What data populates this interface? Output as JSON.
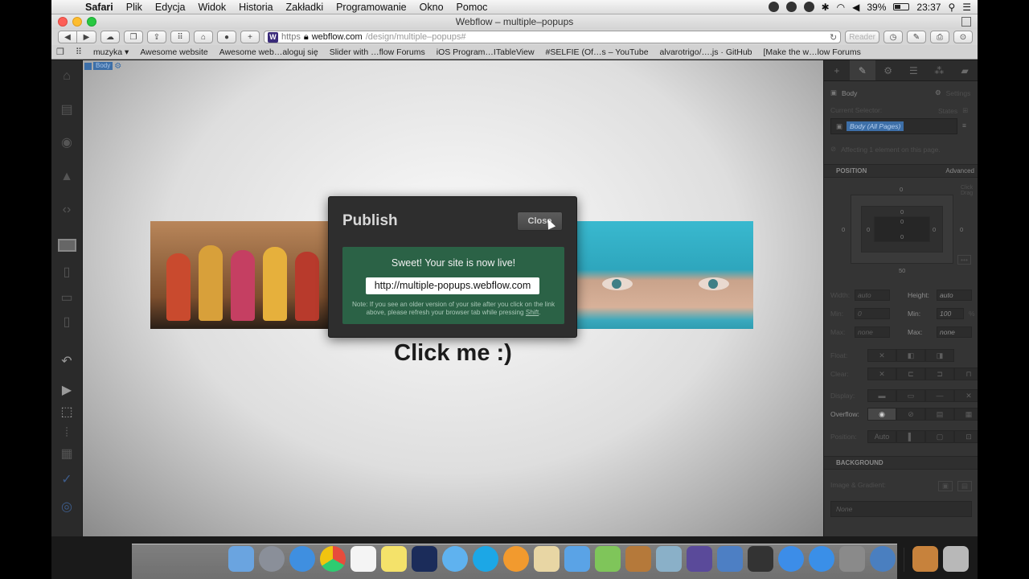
{
  "menubar": {
    "apple": "",
    "items": [
      "Safari",
      "Plik",
      "Edycja",
      "Widok",
      "Historia",
      "Zakładki",
      "Programowanie",
      "Okno",
      "Pomoc"
    ],
    "battery": "39%",
    "clock": "23:37"
  },
  "window": {
    "title": "Webflow – multiple–popups"
  },
  "toolbar": {
    "back": "◀",
    "forward": "▶",
    "plus": "+",
    "address_scheme": "https",
    "address_host": "webflow.com",
    "address_path": "/design/multiple–popups#",
    "reload": "↻",
    "reader": "Reader"
  },
  "bookmarks": [
    "muzyka ▾",
    "Awesome website",
    "Awesome web…aloguj się",
    "Slider with …flow Forums",
    "iOS Program…ITableView",
    "#SELFIE (Of…s – YouTube",
    "alvarotrigo/….js · GitHub",
    "[Make the w…low Forums"
  ],
  "canvas": {
    "body_tag": "Body",
    "click_text": "Click me :)"
  },
  "modal": {
    "title": "Publish",
    "close_label": "Close",
    "live_message": "Sweet! Your site is now live!",
    "live_url": "http://multiple-popups.webflow.com",
    "note_text": "Note: If you see an older version of your site after you click on the link above, please refresh your browser tab while pressing",
    "note_key": "Shift",
    "note_end": "."
  },
  "right_panel": {
    "element_label": "Body",
    "settings_label": "Settings",
    "current_selector_label": "Current Selector:",
    "states_label": "States",
    "selector_chip": "Body (All Pages)",
    "affecting": "Affecting 1 element on this page.",
    "position_section": "POSITION",
    "advanced": "Advanced",
    "click_hint": "Click\nDrag",
    "box_margin_top": "0",
    "box_margin_left": "0",
    "box_margin_right": "0",
    "box_border_top": "0",
    "box_padding_top": "0",
    "box_padding_left": "0",
    "box_padding_right": "0",
    "box_padding_bottom": "0",
    "box_value_50": "50",
    "width_label": "Width:",
    "width_value": "auto",
    "height_label": "Height:",
    "height_value": "auto",
    "min_label": "Min:",
    "min_w_value": "0",
    "min_h_label": "Min:",
    "min_h_value": "100",
    "min_h_unit": "%",
    "max_label": "Max:",
    "max_w_value": "none",
    "max_h_label": "Max:",
    "max_h_value": "none",
    "float_label": "Float:",
    "clear_label": "Clear:",
    "display_label": "Display:",
    "overflow_label": "Overflow:",
    "position_label": "Position:",
    "position_value": "Auto",
    "background_section": "BACKGROUND",
    "image_gradient_label": "Image & Gradient:",
    "none_value": "None"
  },
  "colors": {
    "modal_bg": "#2e2e2e",
    "live_panel": "#2b6246",
    "selector_blue": "#3d6fa8"
  }
}
